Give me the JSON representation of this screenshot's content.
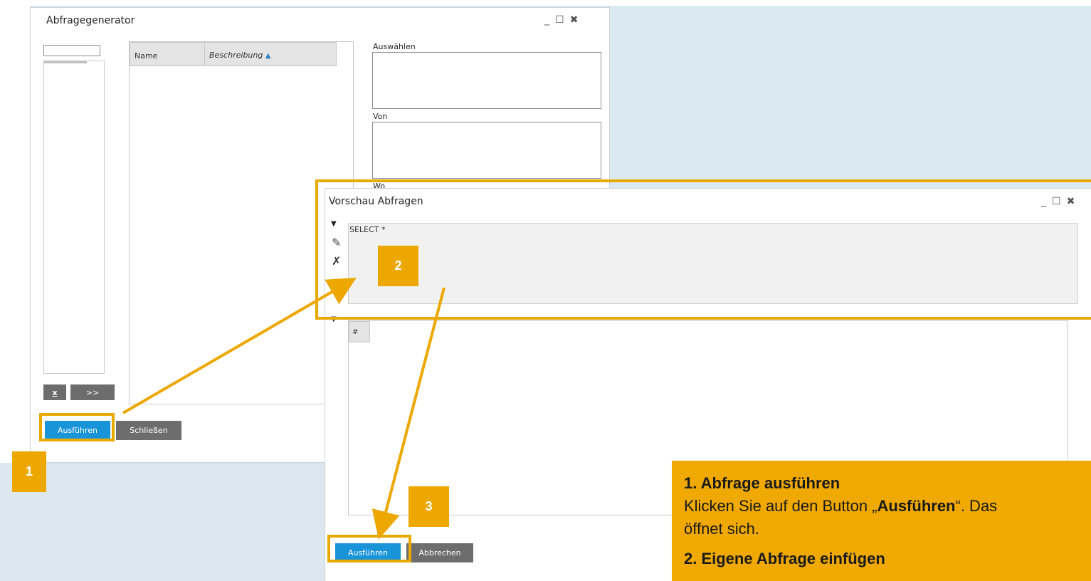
{
  "colors": {
    "accent": "#eda800",
    "button_primary": "#1a94d8",
    "button_secondary": "#6d6d6d",
    "background": "#dbeaf1"
  },
  "query_generator": {
    "title": "Abfragegenerator",
    "controls": {
      "minimize": "_",
      "maximize": "☐",
      "close": "✖"
    },
    "columns": {
      "name": "Name",
      "description": "Beschreibung"
    },
    "sort_icon": "sort-ascending-icon",
    "sections": {
      "select": "Auswählen",
      "from": "Von",
      "where": "Wo"
    },
    "small_buttons": {
      "clear": "x",
      "add": ">>"
    },
    "buttons": {
      "execute": "Ausführen",
      "close": "Schließen"
    }
  },
  "preview": {
    "title": "Vorschau Abfragen",
    "controls": {
      "minimize": "_",
      "maximize": "☐",
      "close": "✖"
    },
    "query_text": "SELECT *",
    "grid_header": "#",
    "icons": {
      "collapse_top": "triangle-down-icon",
      "edit": "pencil-icon",
      "delete": "pencil-cross-icon",
      "collapse_bottom": "triangle-down-icon"
    },
    "buttons": {
      "execute": "Ausführen",
      "cancel": "Abbrechen"
    }
  },
  "badges": {
    "one": "1",
    "two": "2",
    "three": "3"
  },
  "info_box": {
    "heading_1": "1. Abfrage ausführen",
    "text_1_before": "Klicken Sie auf den Button „",
    "text_1_bold": "Ausführen",
    "text_1_after": "“. Das",
    "text_1_line2": "öffnet sich.",
    "heading_2": "2. Eigene Abfrage einfügen"
  }
}
